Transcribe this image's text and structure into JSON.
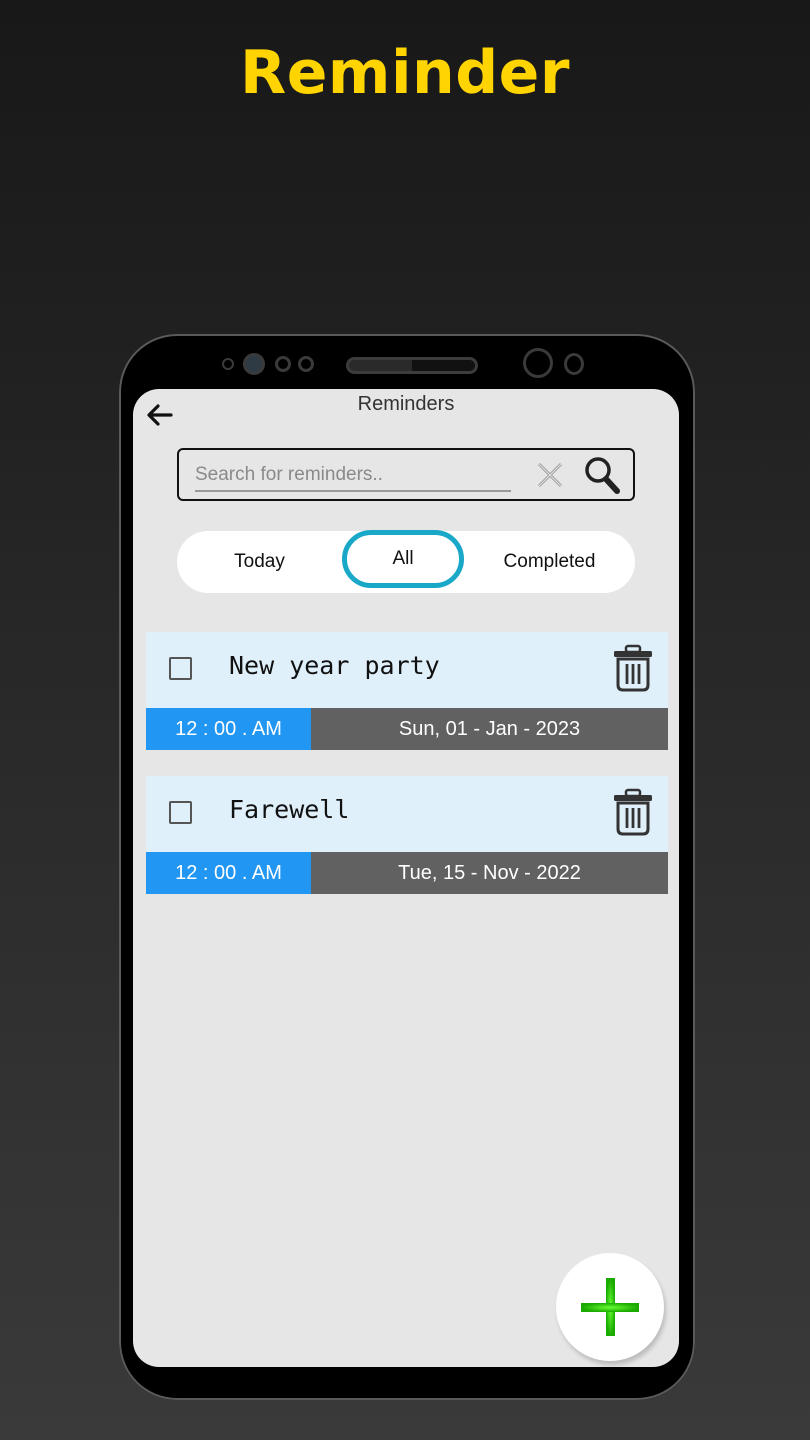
{
  "promo": {
    "title": "Reminder"
  },
  "app": {
    "header": {
      "title": "Reminders",
      "back_icon": "arrow-left-icon"
    },
    "search": {
      "placeholder": "Search for reminders..",
      "value": "",
      "clear_icon": "close-icon",
      "search_icon": "search-icon"
    },
    "tabs": [
      {
        "label": "Today",
        "active": false
      },
      {
        "label": "All",
        "active": true
      },
      {
        "label": "Completed",
        "active": false
      }
    ],
    "reminders": [
      {
        "title": "New year party",
        "time": "12 : 00 . AM",
        "date": "Sun, 01 - Jan - 2023",
        "completed": false
      },
      {
        "title": "Farewell",
        "time": "12 : 00 . AM",
        "date": "Tue, 15 - Nov - 2022",
        "completed": false
      }
    ],
    "fab": {
      "icon": "plus-icon"
    },
    "colors": {
      "accent_yellow": "#ffd400",
      "tab_active_border": "#1aa8c8",
      "time_bg": "#2196f3",
      "date_bg": "#616161",
      "card_bg": "#e0f0fb",
      "fab_plus": "#22cc00"
    }
  }
}
